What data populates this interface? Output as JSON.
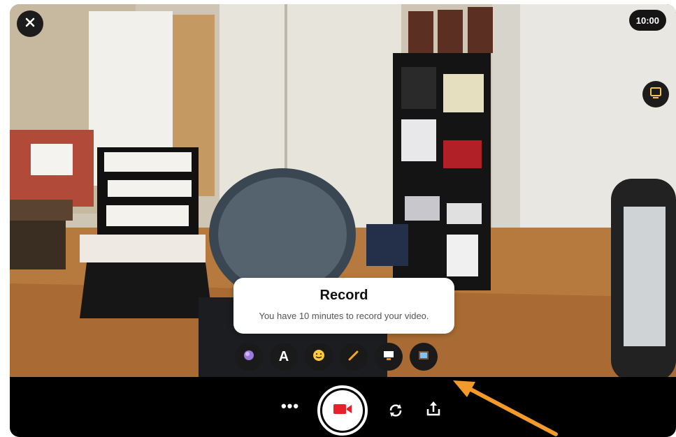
{
  "timer": {
    "label": "10:00"
  },
  "tooltip": {
    "title": "Record",
    "text": "You have 10 minutes to record your video."
  },
  "icons": {
    "close": "close-icon",
    "whiteboard": "whiteboard-icon",
    "lens": "lens-icon",
    "text": "A",
    "sticker": "smiley-icon",
    "pen": "pen-icon",
    "board": "board-icon",
    "frame": "frame-icon",
    "more": "•••",
    "record": "video-camera-icon",
    "flip": "flip-camera-icon",
    "share": "share-icon"
  },
  "colors": {
    "record_accent": "#e8202a",
    "pen": "#f5a623",
    "annotation_arrow": "#f39a2a"
  }
}
